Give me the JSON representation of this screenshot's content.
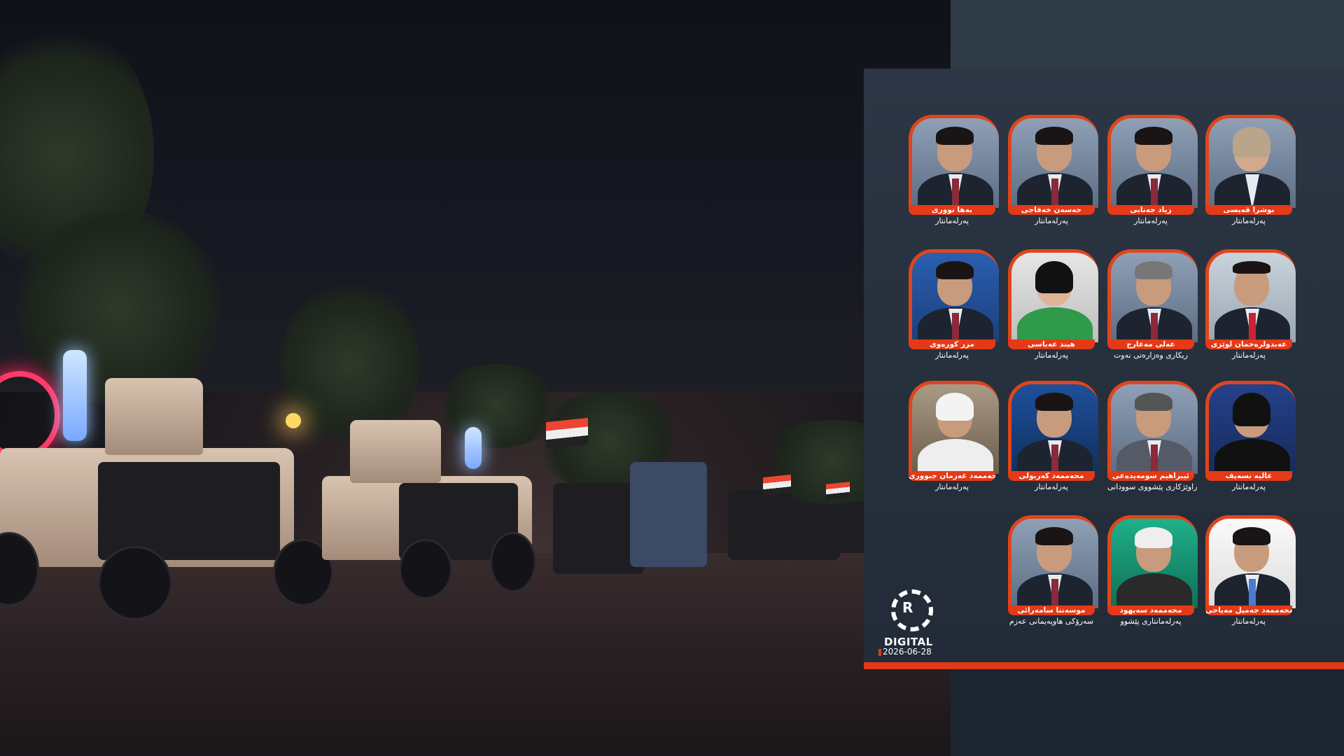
{
  "brand": {
    "logo_letter": "R",
    "logo_word": "DIGITAL",
    "date": "2026-06-28"
  },
  "colors": {
    "accent": "#e03a16",
    "panel": "#2a3340"
  },
  "people": [
    {
      "name": "بەها نووری",
      "role": "پەرلەمانتار"
    },
    {
      "name": "حەسەن خەفاجی",
      "role": "پەرلەمانتار"
    },
    {
      "name": "زیاد جەنابی",
      "role": "پەرلەمانتار"
    },
    {
      "name": "بوشرا قەیسی",
      "role": "پەرلەمانتار"
    },
    {
      "name": "مزر کورەوی",
      "role": "پەرلەمانتار"
    },
    {
      "name": "هیند عەباسی",
      "role": "پەرلەمانتار"
    },
    {
      "name": "عەلی مەعارج",
      "role": "ریکاری وەزارەتی نەوت"
    },
    {
      "name": "عەبدولرەحمان لوێزی",
      "role": "پەرلەمانتار"
    },
    {
      "name": "محەممەد غەزمان جبووری",
      "role": "پەرلەمانتار"
    },
    {
      "name": "محەممەد کەربولی",
      "role": "پەرلەمانتار"
    },
    {
      "name": "ئیبراهیم سومەیدەعی",
      "role": "راوێژکاری پێشووی سوودانی"
    },
    {
      "name": "عالیە نسەیف",
      "role": "پەرلەمانتار"
    },
    {
      "name": "موسەننا سامەرائی",
      "role": "سەرۆکی هاوپەیمانی عەزم"
    },
    {
      "name": "محەممەد سەیهود",
      "role": "پەرلەمانتاری پێشوو"
    },
    {
      "name": "محەممەد جەمیل مەیاحی",
      "role": "پەرلەمانتار"
    }
  ]
}
